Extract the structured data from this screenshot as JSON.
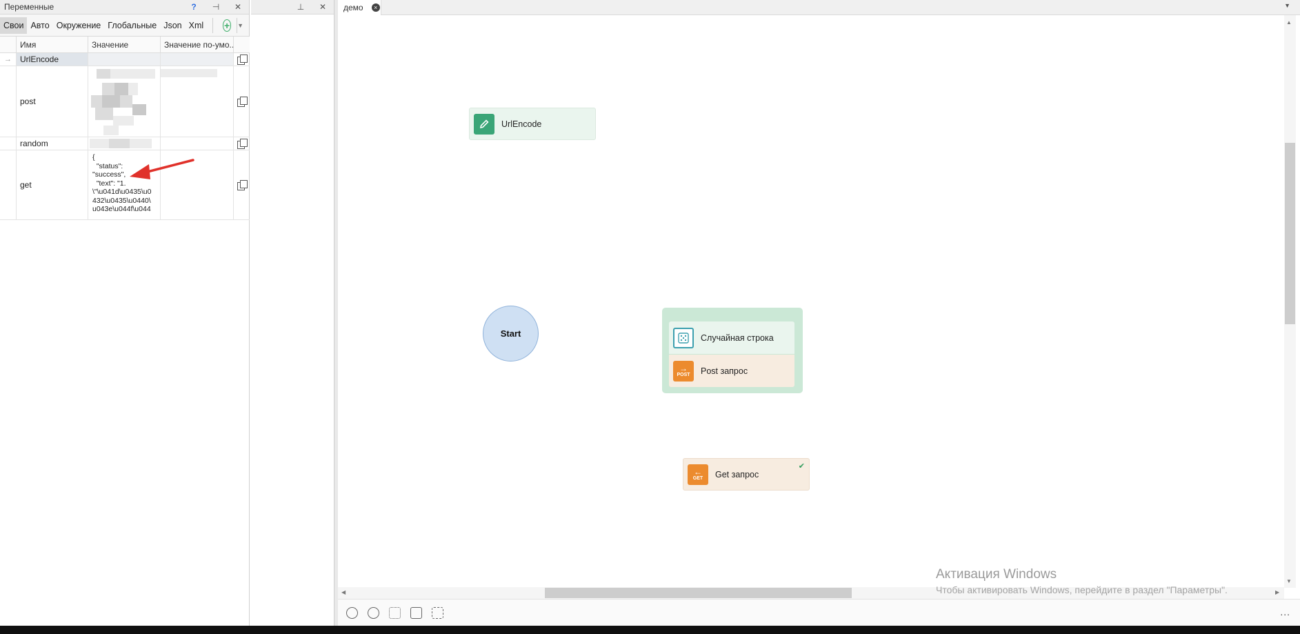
{
  "variables_panel": {
    "title": "Переменные",
    "help": "?",
    "pin": "⊣",
    "close": "✕",
    "tabs": [
      "Свои",
      "Авто",
      "Окружение",
      "Глобальные",
      "Json",
      "Xml"
    ],
    "add_tab": "+",
    "dropdown": "▼",
    "columns": [
      "Имя",
      "Значение",
      "Значение по-умо..."
    ],
    "rows": [
      {
        "name": "UrlEncode",
        "value": "",
        "selected": true
      },
      {
        "name": "post",
        "value": ""
      },
      {
        "name": "random",
        "value": ""
      },
      {
        "name": "get",
        "value": "{\n  \"status\":\n\"success\",\n  \"text\": \"1.\n\\\"\\u041d\\u0435\\u0\n432\\u0435\\u0440\\\nu043e\\u044f\\u044"
      }
    ],
    "row_pointer": "→"
  },
  "middle_panel": {
    "pin": "⊥",
    "close": "✕"
  },
  "document_tab": {
    "title": "демо",
    "close": "×",
    "dropdown": "▼"
  },
  "canvas": {
    "nodes": {
      "urlencode": {
        "label": "UrlEncode",
        "icon": "pencil-icon"
      },
      "start": {
        "label": "Start"
      },
      "random_string": {
        "label": "Случайная строка",
        "icon": "dice-icon"
      },
      "post": {
        "label": "Post запрос",
        "icon": "post-icon",
        "badge": "POST"
      },
      "get": {
        "label": "Get запрос",
        "icon": "get-icon",
        "badge": "GET",
        "status": "✔"
      }
    },
    "watermark_title": "Активация Windows",
    "watermark_text": "Чтобы активировать Windows, перейдите в раздел \"Параметры\"."
  },
  "toolbar": {
    "more": "..."
  },
  "colors": {
    "green_node": "#eaf5ee",
    "orange_node": "#f7ece0",
    "group": "#cbe8d6",
    "start": "#cfe0f3",
    "arrow": "#e0312a"
  }
}
